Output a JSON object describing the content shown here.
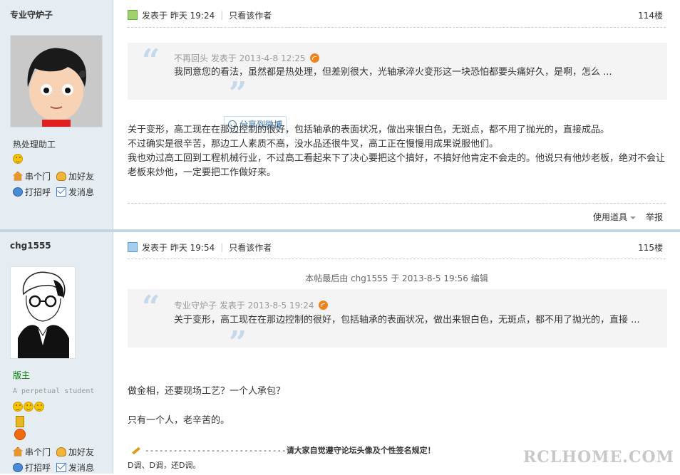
{
  "post1": {
    "username": "专业守炉子",
    "group": "热处理助工",
    "actions": [
      "串个门",
      "加好友",
      "打招呼",
      "发消息"
    ],
    "posted_label": "发表于",
    "posted_time": "昨天 19:24",
    "only_author": "只看该作者",
    "floor": "114楼",
    "quote_author": "不再回头",
    "quote_posted": "发表于 2013-4-8 12:25",
    "quote_text": "我同意您的看法，虽然都是热处理，但差别很大，光轴承淬火变形这一块恐怕都要头痛好久，是啊，怎么 ...",
    "share_label": "分享到微博",
    "body": [
      "关于变形，高工现在在那边控制的很好，包括轴承的表面状况，做出来银白色，无斑点，都不用了抛光的，直接成品。",
      "不过确实是很辛苦，那边工人素质不高，没水品还很牛叉，高工正在慢慢用成果说服他们。",
      "我也劝过高工回到工程机械行业，不过高工看起来下了决心要把这个搞好，不搞好他肯定不会走的。他说只有他炒老板，绝对不会让老板来炒他，一定要把工作做好来。"
    ],
    "tools_label": "使用道具",
    "report_label": "举报"
  },
  "post2": {
    "username": "chg1555",
    "group": "版主",
    "user_title": "A perpetual student",
    "actions": [
      "串个门",
      "加好友",
      "打招呼",
      "发消息"
    ],
    "posted_label": "发表于",
    "posted_time": "昨天 19:54",
    "only_author": "只看该作者",
    "floor": "115楼",
    "edit_note": "本帖最后由 chg1555 于 2013-8-5 19:56 编辑",
    "quote_author": "专业守炉子",
    "quote_posted": "发表于 2013-8-5 19:24",
    "quote_text": "关于变形，高工现在在那边控制的很好，包括轴承的表面状况，做出来银白色，无斑点，都不用了抛光的，直接 ...",
    "body": [
      "做金相，还要现场工艺？一个人承包？",
      "只有一个人，老辛苦的。"
    ],
    "signature_line": "------------------------------",
    "signature_text": "请大家自觉遵守论坛头像及个性签名规定！",
    "signature_line2": "D调、D调，还D调。"
  },
  "watermark": "RCLHOME.COM",
  "colors": {
    "sidebar_bg": "#e5edf2",
    "quote_bg": "#f4f4f4",
    "link": "#3377b5",
    "moderator": "#008000"
  }
}
